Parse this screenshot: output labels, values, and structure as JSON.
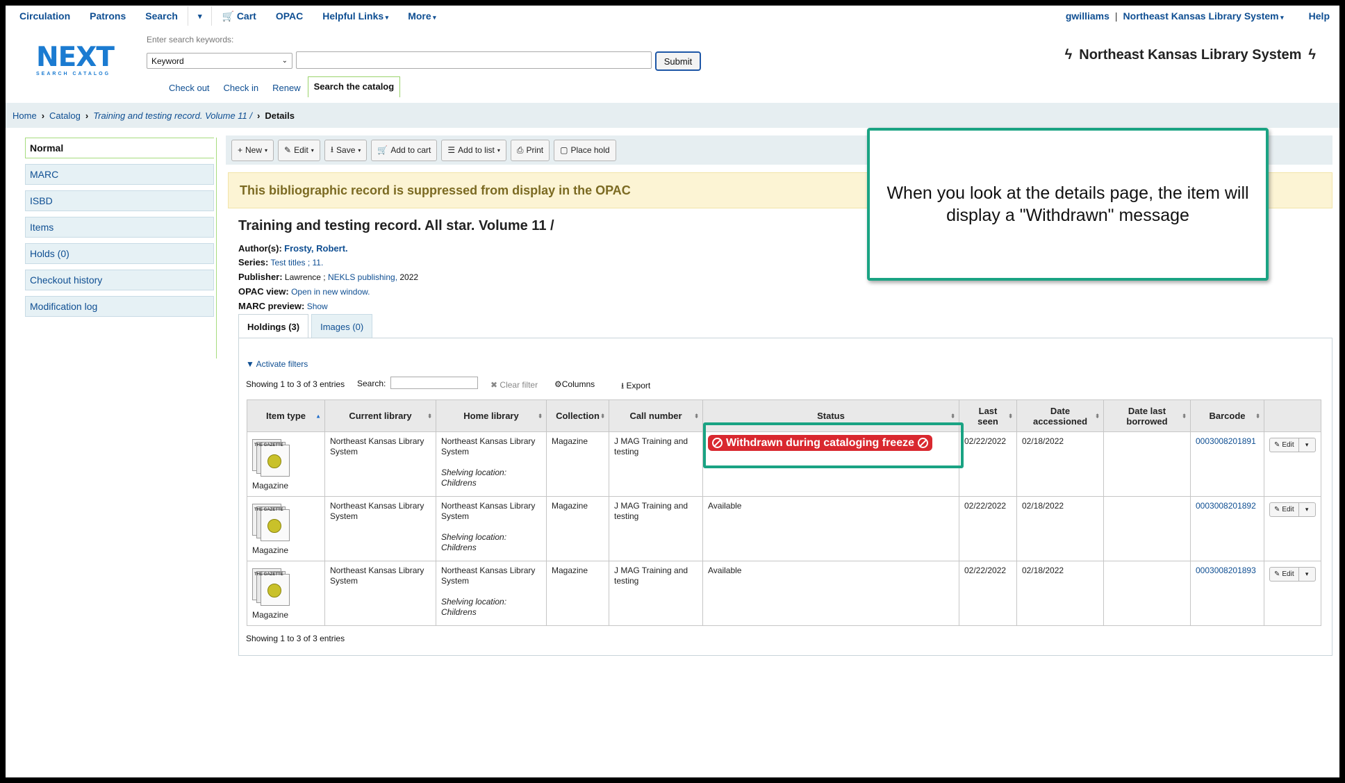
{
  "topnav": {
    "items": [
      "Circulation",
      "Patrons",
      "Search",
      "▾",
      "Cart",
      "OPAC",
      "Helpful Links",
      "More"
    ],
    "user": "gwilliams",
    "library": "Northeast Kansas Library System",
    "help": "Help"
  },
  "header": {
    "logo_word": "NEXT",
    "logo_sub": "SEARCH CATALOG",
    "search_label": "Enter search keywords:",
    "search_type": "Keyword",
    "submit": "Submit",
    "tabs": [
      "Check out",
      "Check in",
      "Renew",
      "Search the catalog"
    ],
    "site_title": "Northeast Kansas Library System"
  },
  "breadcrumb": {
    "home": "Home",
    "catalog": "Catalog",
    "record": "Training and testing record. Volume 11 /",
    "current": "Details"
  },
  "sidebar": {
    "items": [
      "Normal",
      "MARC",
      "ISBD",
      "Items",
      "Holds (0)",
      "Checkout history",
      "Modification log"
    ]
  },
  "toolbar": {
    "buttons": [
      "New",
      "Edit",
      "Save",
      "Add to cart",
      "Add to list",
      "Print",
      "Place hold"
    ]
  },
  "suppressed_message": "This bibliographic record is suppressed from display in the OPAC",
  "record": {
    "title": "Training and testing record. All star. Volume 11 /",
    "author_label": "Author(s):",
    "author": "Frosty, Robert.",
    "series_label": "Series:",
    "series": "Test titles ; 11.",
    "publisher_label": "Publisher:",
    "publisher_place": "Lawrence ;",
    "publisher": "NEKLS publishing,",
    "publisher_year": "2022",
    "opac_label": "OPAC view:",
    "opac_link": "Open in new window.",
    "marc_label": "MARC preview:",
    "marc_link": "Show"
  },
  "holdings": {
    "tabs": [
      "Holdings (3)",
      "Images (0)"
    ],
    "activate_filters": "Activate filters",
    "showing": "Showing 1 to 3 of 3 entries",
    "search_label": "Search:",
    "clear_filter": "Clear filter",
    "columns": "Columns",
    "export": "Export",
    "headers": [
      "Item type",
      "Current library",
      "Home library",
      "Collection",
      "Call number",
      "Status",
      "Last seen",
      "Date accessioned",
      "Date last borrowed",
      "Barcode",
      ""
    ],
    "rows": [
      {
        "item_type": "Magazine",
        "current_library": "Northeast Kansas Library System",
        "home_library": "Northeast Kansas Library System",
        "shelving": "Shelving location: Childrens",
        "collection": "Magazine",
        "call_number": "J MAG Training and testing",
        "status": "Withdrawn during cataloging freeze",
        "last_seen": "02/22/2022",
        "accessioned": "02/18/2022",
        "last_borrowed": "",
        "barcode": "0003008201891",
        "edit": "Edit"
      },
      {
        "item_type": "Magazine",
        "current_library": "Northeast Kansas Library System",
        "home_library": "Northeast Kansas Library System",
        "shelving": "Shelving location: Childrens",
        "collection": "Magazine",
        "call_number": "J MAG Training and testing",
        "status": "Available",
        "last_seen": "02/22/2022",
        "accessioned": "02/18/2022",
        "last_borrowed": "",
        "barcode": "0003008201892",
        "edit": "Edit"
      },
      {
        "item_type": "Magazine",
        "current_library": "Northeast Kansas Library System",
        "home_library": "Northeast Kansas Library System",
        "shelving": "Shelving location: Childrens",
        "collection": "Magazine",
        "call_number": "J MAG Training and testing",
        "status": "Available",
        "last_seen": "02/22/2022",
        "accessioned": "02/18/2022",
        "last_borrowed": "",
        "barcode": "0003008201893",
        "edit": "Edit"
      }
    ]
  },
  "callout": "When you look at the details page, the item will display a \"Withdrawn\" message",
  "colors": {
    "accent": "#1aa383",
    "link": "#0e4e92",
    "withdrawn": "#d9282f"
  }
}
